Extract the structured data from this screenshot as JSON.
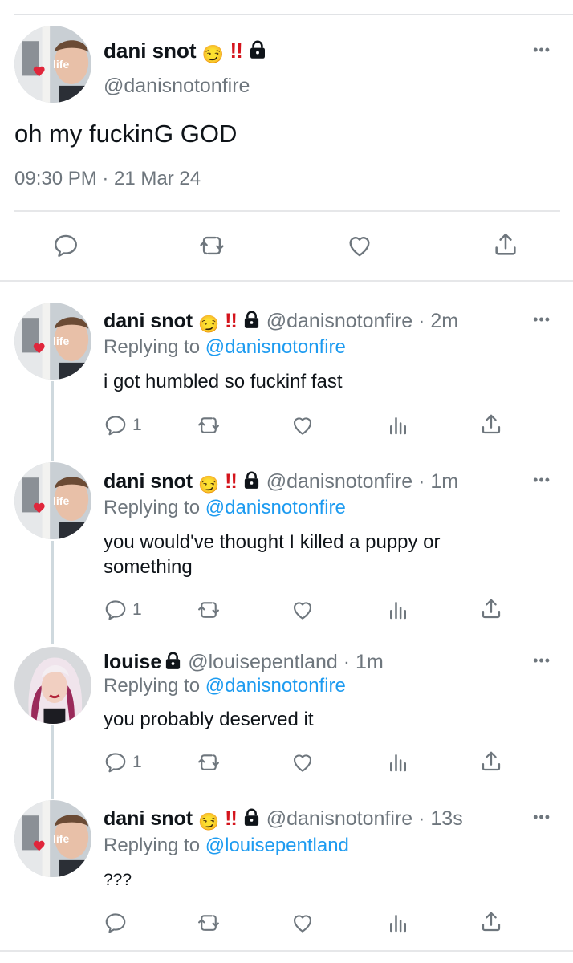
{
  "main_tweet": {
    "display_name": "dani snot",
    "emoji": "😏",
    "bangs": "!!",
    "handle": "@danisnotonfire",
    "text": "oh my fuckinG GOD",
    "timestamp": "09:30 PM · 21 Mar 24",
    "avatar_text": "life"
  },
  "replies": [
    {
      "display_name": "dani snot",
      "emoji": "😏",
      "bangs": "!!",
      "handle": "@danisnotonfire",
      "time": "· 2m",
      "replying_prefix": "Replying to",
      "replying_to": "@danisnotonfire",
      "text": "i got humbled so fuckinf fast",
      "reply_count": "1",
      "avatar_text": "life"
    },
    {
      "display_name": "dani snot",
      "emoji": "😏",
      "bangs": "!!",
      "handle": "@danisnotonfire",
      "time": "· 1m",
      "replying_prefix": "Replying to",
      "replying_to": "@danisnotonfire",
      "text": "you would've thought I killed a puppy or something",
      "reply_count": "1",
      "avatar_text": "life"
    },
    {
      "display_name": "louise",
      "handle": "@louisepentland",
      "time": "· 1m",
      "replying_prefix": "Replying to",
      "replying_to": "@danisnotonfire",
      "text": "you probably deserved it",
      "reply_count": "1"
    },
    {
      "display_name": "dani snot",
      "emoji": "😏",
      "bangs": "!!",
      "handle": "@danisnotonfire",
      "time": "· 13s",
      "replying_prefix": "Replying to",
      "replying_to": "@louisepentland",
      "text": "???",
      "reply_count": "",
      "avatar_text": "life"
    }
  ],
  "icons": {
    "more": "ellipsis-icon",
    "reply": "speech-bubble-icon",
    "retweet": "retweet-icon",
    "like": "heart-icon",
    "views": "bar-chart-icon",
    "share": "share-icon",
    "lock": "lock-icon"
  },
  "colors": {
    "link": "#1d9bf0",
    "muted": "#6e767d",
    "bangs": "#d4141c",
    "divider": "#e6e7e9"
  }
}
